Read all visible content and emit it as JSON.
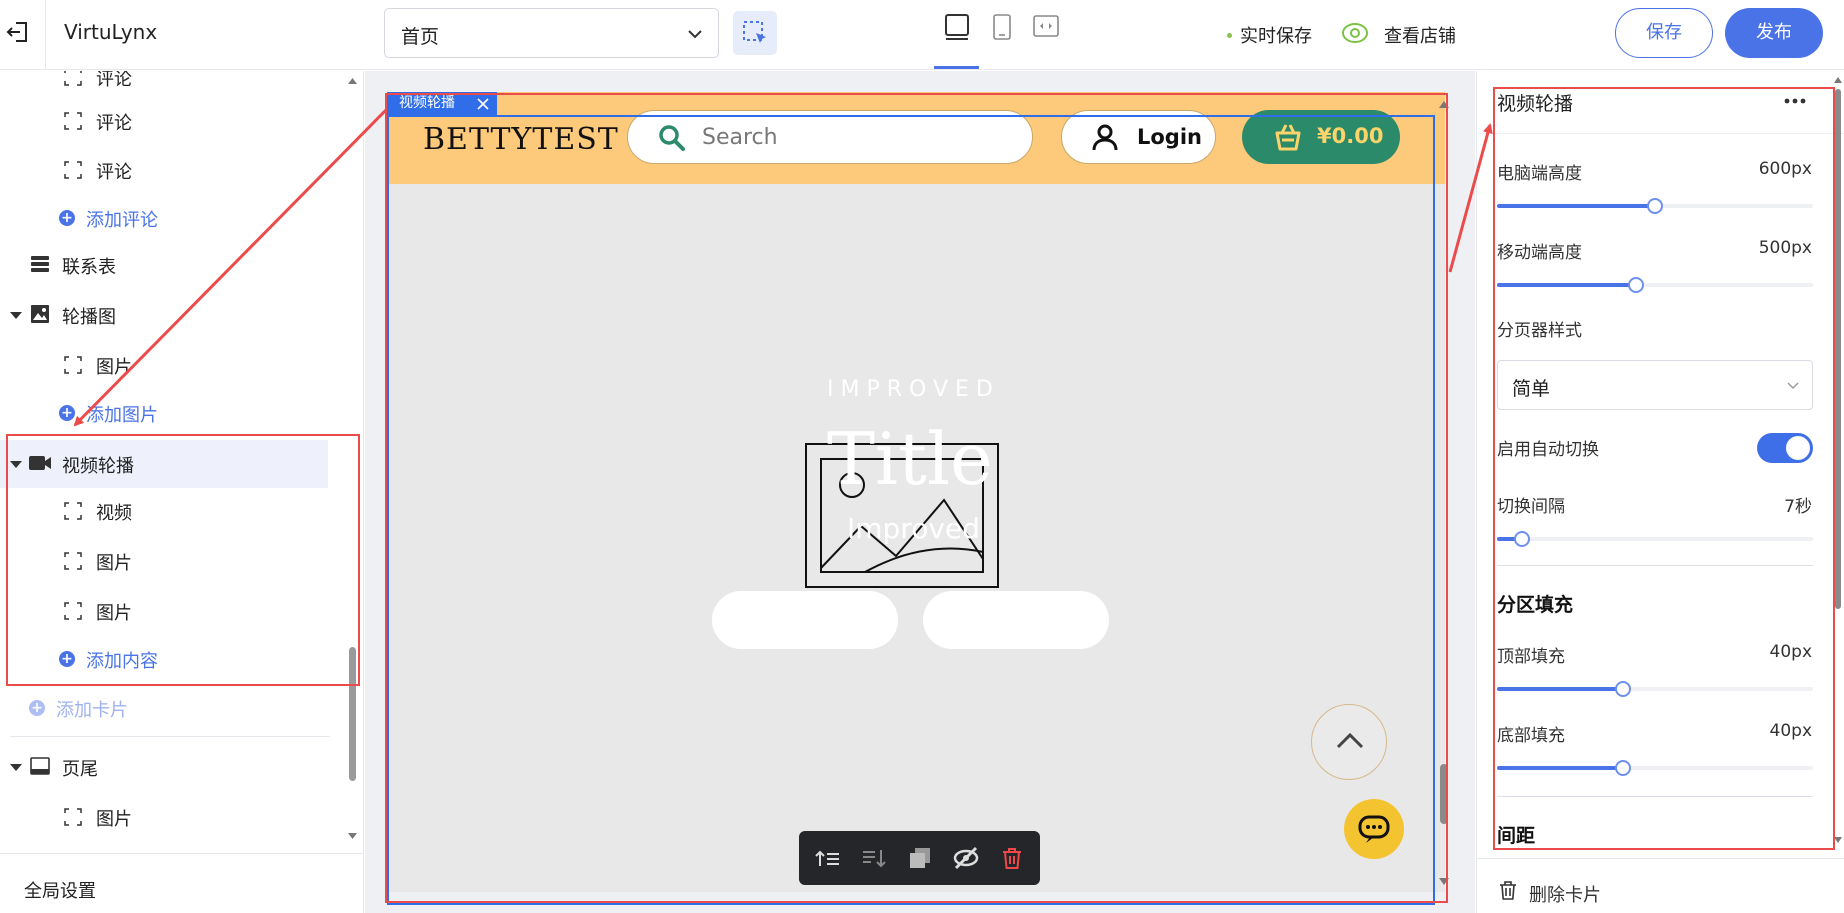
{
  "topbar": {
    "app_title": "VirtuLynx",
    "page_select_value": "首页",
    "live_save": "实时保存",
    "view_store": "查看店铺",
    "save": "保存",
    "publish": "发布"
  },
  "tree": {
    "comment_partial": "评论",
    "comment_1": "评论",
    "comment_2": "评论",
    "add_comment": "添加评论",
    "contact_form": "联系表",
    "carousel": "轮播图",
    "carousel_image": "图片",
    "add_image": "添加图片",
    "video_carousel": "视频轮播",
    "video": "视频",
    "image_1": "图片",
    "image_2": "图片",
    "add_content": "添加内容",
    "add_card": "添加卡片",
    "footer": "页尾",
    "footer_image": "图片",
    "global_settings": "全局设置"
  },
  "preview": {
    "block_tag": "视频轮播",
    "brand": "BETTYTEST",
    "search_placeholder": "Search",
    "login": "Login",
    "cart_total": "¥0.00",
    "hero_kicker": "IMPROVED",
    "hero_title": "Title",
    "hero_subtitle": "Improved"
  },
  "panel": {
    "title": "视频轮播",
    "desktop_height_label": "电脑端高度",
    "desktop_height_value": "600px",
    "desktop_height_fraction": 0.5,
    "mobile_height_label": "移动端高度",
    "mobile_height_value": "500px",
    "mobile_height_fraction": 0.44,
    "pager_style_label": "分页器样式",
    "pager_style_value": "简单",
    "autoplay_label": "启用自动切换",
    "autoplay_on": true,
    "interval_label": "切换间隔",
    "interval_value": "7秒",
    "interval_fraction": 0.08,
    "padding_section": "分区填充",
    "top_padding_label": "顶部填充",
    "top_padding_value": "40px",
    "top_padding_fraction": 0.4,
    "bottom_padding_label": "底部填充",
    "bottom_padding_value": "40px",
    "bottom_padding_fraction": 0.4,
    "spacing_section": "间距",
    "delete_card": "删除卡片"
  },
  "colors": {
    "accent": "#4a73e8",
    "header_bg": "#fdc97a",
    "cart_bg": "#2a8a6a",
    "annotation": "#ec4b4b"
  },
  "icons": [
    "exit-icon",
    "chevron-down-icon",
    "select-tool-icon",
    "desktop-icon",
    "mobile-icon",
    "fit-icon",
    "eye-icon",
    "frame-icon",
    "plus-circle-icon",
    "table-icon",
    "image-icon",
    "video-icon",
    "footer-icon",
    "search-icon",
    "user-icon",
    "basket-icon",
    "image-placeholder-icon",
    "arrow-up-icon",
    "chat-icon",
    "move-up-icon",
    "move-down-icon",
    "duplicate-icon",
    "hide-icon",
    "trash-icon",
    "more-icon"
  ]
}
